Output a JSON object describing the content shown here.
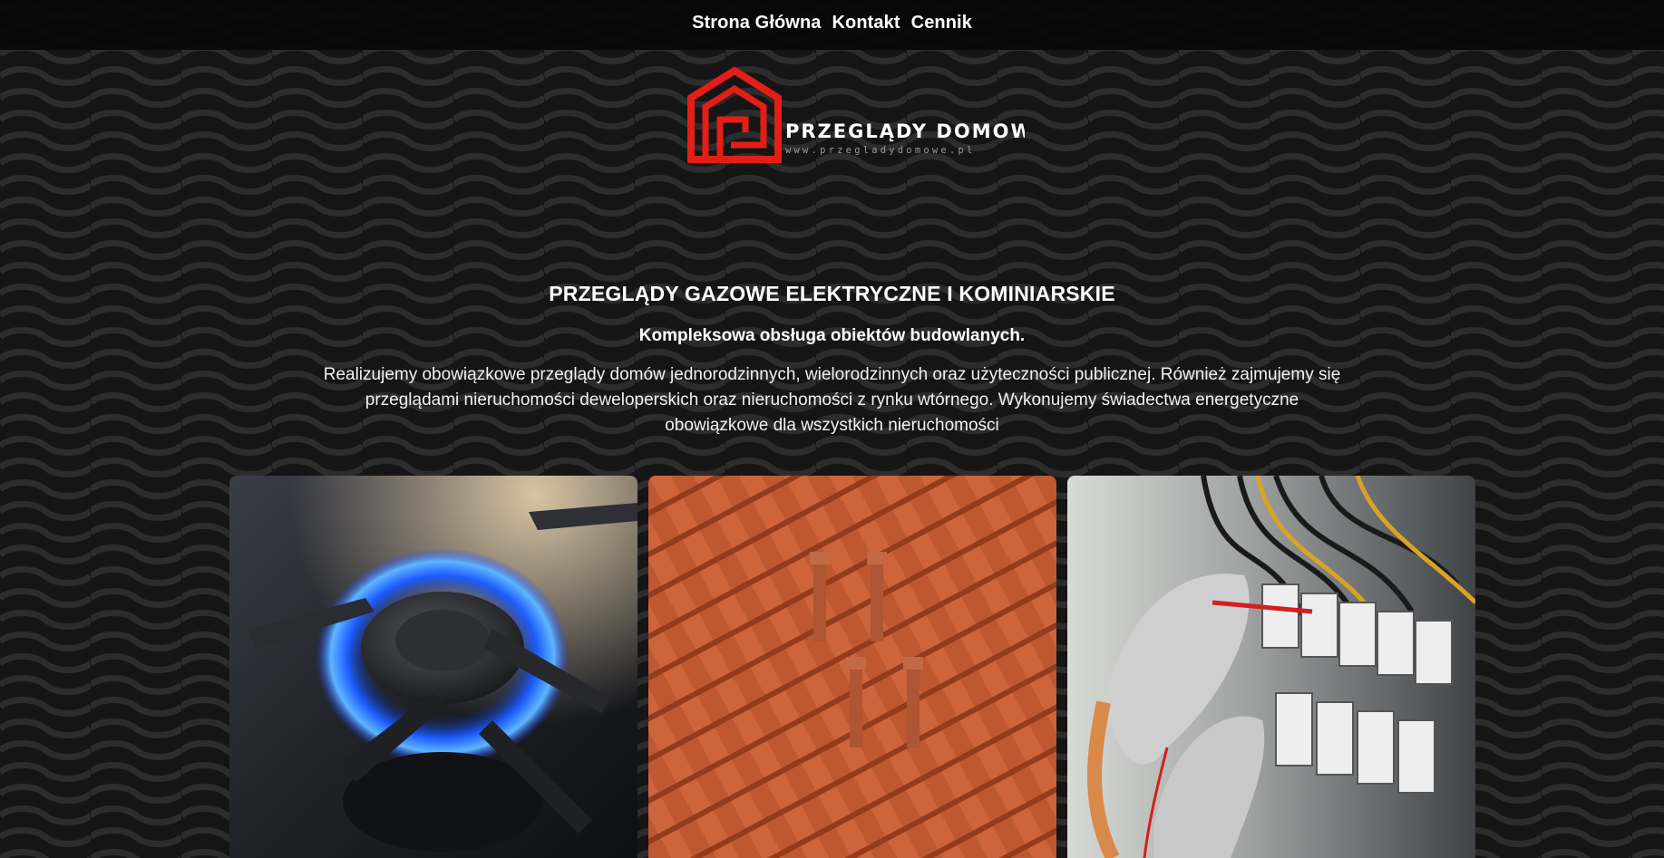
{
  "nav": {
    "items": [
      {
        "label": "Strona Główna"
      },
      {
        "label": "Kontakt"
      },
      {
        "label": "Cennik"
      }
    ]
  },
  "logo": {
    "name": "PRZEGLĄDY DOMOWE",
    "url_text": "www.przegladydomowe.pl",
    "color": "#e31e16"
  },
  "hero": {
    "title": "PRZEGLĄDY GAZOWE ELEKTRYCZNE I KOMINIARSKIE",
    "subtitle": "Kompleksowa obsługa obiektów budowlanych.",
    "description": "Realizujemy obowiązkowe przeglądy domów jednorodzinnych, wielorodzinnych oraz użyteczności publicznej. Również zajmujemy się przeglądami nieruchomości deweloperskich oraz nieruchomości z rynku wtórnego. Wykonujemy świadectwa energetyczne obowiązkowe dla wszystkich nieruchomości"
  },
  "cards": [
    {
      "subject": "gas-burner-photo"
    },
    {
      "subject": "roof-vent-photo"
    },
    {
      "subject": "electrical-panel-photo"
    }
  ],
  "colors": {
    "background": "#141414",
    "accent": "#e31e16",
    "text": "#ffffff"
  }
}
